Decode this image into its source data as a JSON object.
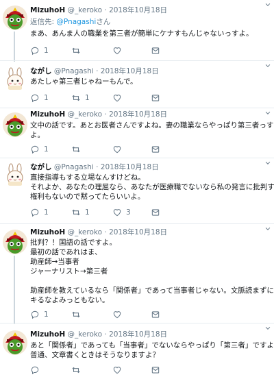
{
  "tweets": [
    {
      "name": "MizuhoH",
      "handle": "@_keroko",
      "sep": "·",
      "date": "2018年10月18日",
      "reply_prefix": "返信先: ",
      "reply_mention": "@Pnagashi",
      "reply_suffix": "さん",
      "lines": [
        "まあ、あんま人の職業を第三者が簡単にケナすもんじゃないっすよ。"
      ],
      "reply_count": "1",
      "retweet_count": "",
      "like_count": "",
      "avatar_icon": "frog-character-avatar-icon"
    },
    {
      "name": "ながし",
      "handle": "@Pnagashi",
      "sep": "·",
      "date": "2018年10月18日",
      "lines": [
        "あたしゃ第三者じゃねーもんで。"
      ],
      "reply_count": "1",
      "retweet_count": "1",
      "like_count": "",
      "avatar_icon": "rabbit-character-avatar-icon"
    },
    {
      "name": "MizuhoH",
      "handle": "@_keroko",
      "sep": "·",
      "date": "2018年10月18日",
      "lines": [
        "文中の話です。あとお医者さんですよね。妻の職業ならやっぱり第三者っす",
        "よ。"
      ],
      "reply_count": "1",
      "retweet_count": "",
      "like_count": "",
      "avatar_icon": "frog-character-avatar-icon"
    },
    {
      "name": "ながし",
      "handle": "@Pnagashi",
      "sep": "·",
      "date": "2018年10月18日",
      "lines": [
        "直接指導もする立場なんすけどね。",
        "それよか、あなたの理屈なら、あなたが医療職でないなら私の発言に批判する",
        "権利もないので黙ってたらいいよ。"
      ],
      "reply_count": "1",
      "retweet_count": "1",
      "like_count": "3",
      "avatar_icon": "rabbit-character-avatar-icon"
    },
    {
      "name": "MizuhoH",
      "handle": "@_keroko",
      "sep": "·",
      "date": "2018年10月18日",
      "lines": [
        "批判？！国語の話ですよ。",
        "最初の話であれはま、",
        "助産師→当事者",
        "ジャーナリスト→第三者",
        "",
        "助産師を教えているなら「関係者」であって当事者じゃない。文脈読まずにイ",
        "キるなよみっともない。"
      ],
      "reply_count": "1",
      "retweet_count": "",
      "like_count": "",
      "avatar_icon": "frog-character-avatar-icon"
    },
    {
      "name": "MizuhoH",
      "handle": "@_keroko",
      "sep": "·",
      "date": "2018年10月18日",
      "lines": [
        "あと「関係者」であっても「当事者」でないならやっぱり「第三者」ですよ。",
        "普通、文章書くときはそうなりますよ？"
      ],
      "reply_count": "",
      "retweet_count": "",
      "like_count": "",
      "avatar_icon": "frog-character-avatar-icon"
    }
  ],
  "icons": {
    "reply": "reply-icon",
    "retweet": "retweet-icon",
    "like": "like-icon",
    "dm": "direct-message-icon",
    "caret": "chevron-down-icon"
  },
  "colors": {
    "link": "#1b95e0",
    "meta": "#657786",
    "thread_line": "#ccd6dd"
  }
}
